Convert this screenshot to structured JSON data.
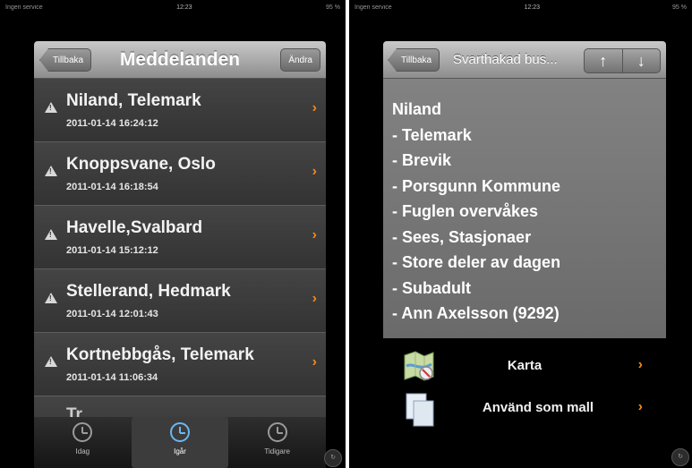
{
  "left": {
    "statusbar": {
      "carrier": "Ingen service",
      "time": "12:23",
      "battery": "95 %"
    },
    "nav": {
      "back_label": "Tillbaka",
      "title": "Meddelanden",
      "edit_label": "Ändra"
    },
    "rows": [
      {
        "title": "Niland, Telemark",
        "date": "2011-01-14 16:24:12"
      },
      {
        "title": "Knoppsvane, Oslo",
        "date": "2011-01-14 16:18:54"
      },
      {
        "title": "Havelle,Svalbard",
        "date": "2011-01-14 15:12:12"
      },
      {
        "title": "Stellerand, Hedmark",
        "date": "2011-01-14 12:01:43"
      },
      {
        "title": "Kortnebbgås, Telemark",
        "date": "2011-01-14 11:06:34"
      }
    ],
    "partial_row": "Tr...",
    "tabs": [
      {
        "label": "Idag",
        "active": false
      },
      {
        "label": "Igår",
        "active": true
      },
      {
        "label": "Tidigare",
        "active": false
      }
    ],
    "corner_label": "↻"
  },
  "right": {
    "statusbar": {
      "carrier": "Ingen service",
      "time": "12:23",
      "battery": "95 %"
    },
    "nav": {
      "back_label": "Tillbaka",
      "title": "Svarthakad bus...",
      "up_icon": "arrow-up-icon",
      "down_icon": "arrow-down-icon"
    },
    "detail_lines": [
      "Niland",
      "- Telemark",
      "- Brevik",
      "- Porsgunn Kommune",
      "- Fuglen overvåkes",
      "- Sees, Stasjonaer",
      "- Store deler av dagen",
      "- Subadult",
      "- Ann Axelsson (9292)"
    ],
    "actions": [
      {
        "label": "Karta",
        "icon": "map-icon"
      },
      {
        "label": "Använd som mall",
        "icon": "documents-icon"
      }
    ],
    "corner_label": "↻"
  },
  "colors": {
    "accent_chevron": "#f18a1c",
    "active_tab": "#6ab8f0"
  }
}
